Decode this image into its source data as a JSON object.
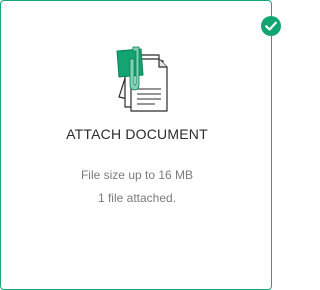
{
  "attach_card": {
    "title": "ATTACH DOCUMENT",
    "size_limit": "File size up to 16 MB",
    "attached_status": "1 file attached.",
    "status_icon": "check-circle-icon",
    "document_icon": "document-with-clip-icon"
  },
  "colors": {
    "accent": "#13a571",
    "border": "#18a77a",
    "title_text": "#2b2b2b",
    "muted_text": "#7b7b7b"
  }
}
